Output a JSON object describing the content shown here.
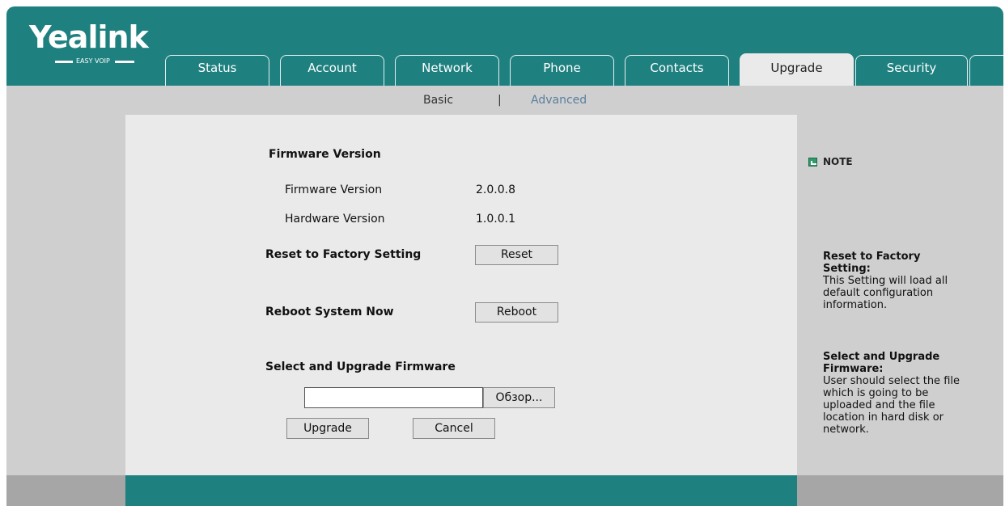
{
  "brand": {
    "name": "Yealink",
    "tagline": "EASY VOIP"
  },
  "tabs": [
    {
      "label": "Status"
    },
    {
      "label": "Account"
    },
    {
      "label": "Network"
    },
    {
      "label": "Phone"
    },
    {
      "label": "Contacts"
    },
    {
      "label": "Upgrade"
    },
    {
      "label": "Security"
    }
  ],
  "active_tab": "Upgrade",
  "subnav": {
    "basic": "Basic",
    "separator": "|",
    "advanced": "Advanced"
  },
  "main": {
    "firmware_heading": "Firmware Version",
    "firmware_label": "Firmware Version",
    "firmware_value": "2.0.0.8",
    "hardware_label": "Hardware Version",
    "hardware_value": "1.0.0.1",
    "reset_label": "Reset to Factory Setting",
    "reset_button": "Reset",
    "reboot_label": "Reboot System Now",
    "reboot_button": "Reboot",
    "upgrade_heading": "Select and Upgrade Firmware",
    "file_value": "",
    "browse_button": "Обзор...",
    "upgrade_button": "Upgrade",
    "cancel_button": "Cancel"
  },
  "note": {
    "title": "NOTE",
    "reset_title_1": "Reset to Factory",
    "reset_title_2": "Setting:",
    "reset_lines": [
      "This Setting will load all",
      "default configuration",
      "information."
    ],
    "upgrade_title_1": "Select and Upgrade",
    "upgrade_title_2": "Firmware:",
    "upgrade_lines": [
      "User should select the file",
      "which is going to be",
      "uploaded and the file",
      "location in hard disk or",
      "network."
    ]
  },
  "colors": {
    "teal": "#1f8080",
    "panel": "#eaeaea",
    "side": "#cfcfcf",
    "footer_side": "#a6a6a6",
    "link": "#5a7fa0"
  }
}
